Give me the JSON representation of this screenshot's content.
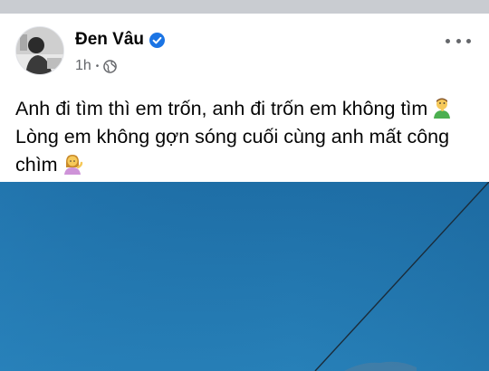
{
  "post": {
    "author": {
      "name": "Đen Vâu",
      "verified_icon": "verified-badge-icon",
      "avatar_icon": "avatar"
    },
    "time": "1h",
    "separator": "•",
    "audience_icon": "globe-icon",
    "more_icon": "more-options-icon",
    "text_lines": [
      "Anh đi tìm thì em trốn, anh đi trốn em không tìm",
      "Lòng em không gợn sóng cuối cùng anh mất công",
      "chìm"
    ],
    "emoji_1": "man-shushing-emoji",
    "emoji_2": "woman-tipping-hand-emoji",
    "photo": "sky-photo"
  },
  "colors": {
    "name": "#050505",
    "meta": "#65676b",
    "verified": "#1b74e4",
    "sky_top": "#1e6ea6",
    "sky_bottom": "#2780b8",
    "top_strip": "#c9ccd1"
  }
}
